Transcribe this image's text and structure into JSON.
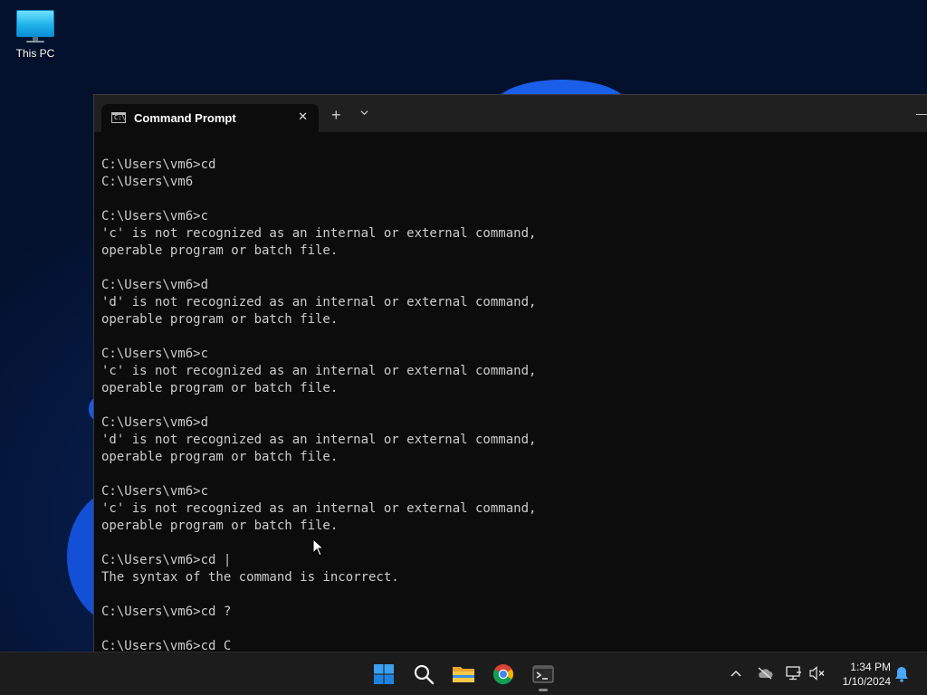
{
  "desktop": {
    "icons": [
      {
        "label": "This PC",
        "icon": "monitor-icon"
      }
    ]
  },
  "window": {
    "tab_title": "Command Prompt",
    "tab_icon": "cmd-icon",
    "tab_icon_glyph": "C:\\",
    "close_glyph": "✕",
    "new_tab_glyph": "+",
    "dropdown_icon": "chevron-down-icon",
    "minimize_glyph": "—",
    "console_lines": [
      "C:\\Users\\vm6>cd",
      "C:\\Users\\vm6",
      "",
      "C:\\Users\\vm6>c",
      "'c' is not recognized as an internal or external command,",
      "operable program or batch file.",
      "",
      "C:\\Users\\vm6>d",
      "'d' is not recognized as an internal or external command,",
      "operable program or batch file.",
      "",
      "C:\\Users\\vm6>c",
      "'c' is not recognized as an internal or external command,",
      "operable program or batch file.",
      "",
      "C:\\Users\\vm6>d",
      "'d' is not recognized as an internal or external command,",
      "operable program or batch file.",
      "",
      "C:\\Users\\vm6>c",
      "'c' is not recognized as an internal or external command,",
      "operable program or batch file.",
      "",
      "C:\\Users\\vm6>cd |",
      "The syntax of the command is incorrect.",
      "",
      "C:\\Users\\vm6>cd ?",
      "",
      "C:\\Users\\vm6>cd C"
    ]
  },
  "taskbar": {
    "apps": [
      "start-icon",
      "search-icon",
      "file-explorer-icon",
      "chrome-icon",
      "terminal-icon"
    ],
    "tray": [
      "chevron-up-icon",
      "onedrive-icon",
      "network-icon",
      "volume-muted-icon"
    ],
    "time": "1:34 PM",
    "date": "1/10/2024"
  },
  "colors": {
    "console_bg": "#0c0c0c",
    "console_text": "#cccccc",
    "titlebar_bg": "#202020",
    "taskbar_bg": "#1c1c1c",
    "accent_blue": "#0078d4"
  }
}
